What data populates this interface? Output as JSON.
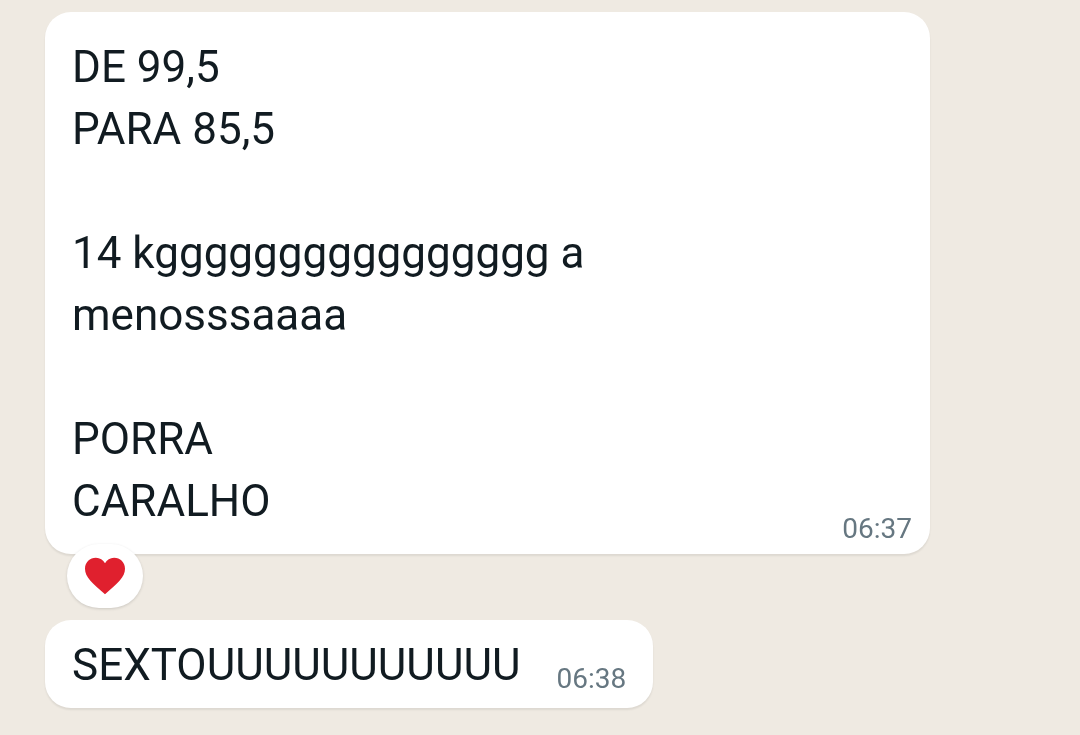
{
  "messages": [
    {
      "text": "DE 99,5\nPARA 85,5\n\n14 kgggggggggggggggg a menosssaaaa\n\nPORRA\nCARALHO",
      "time": "06:37",
      "reacted": true
    },
    {
      "text": "SEXTOUUUUUUUUUUU",
      "time": "06:38",
      "reacted": false
    }
  ]
}
